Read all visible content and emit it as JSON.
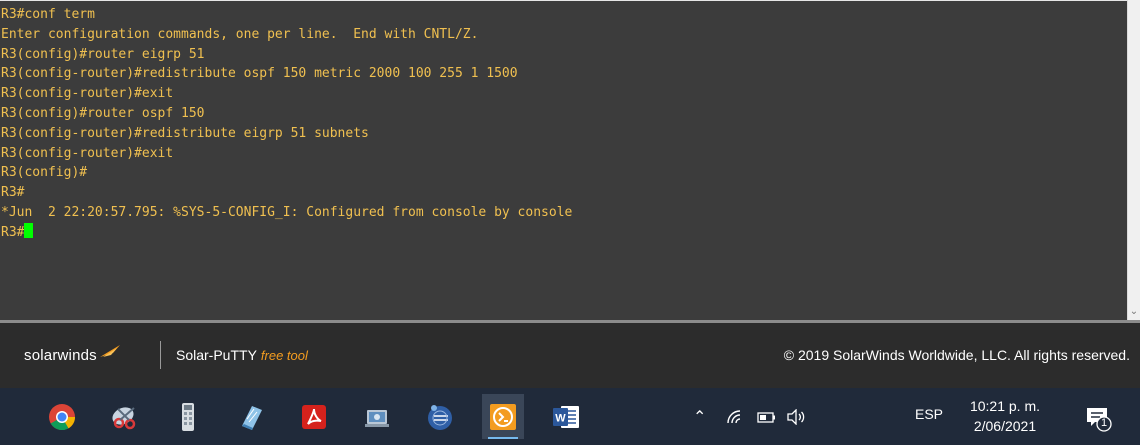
{
  "terminal": {
    "lines": [
      "R3#conf term",
      "Enter configuration commands, one per line.  End with CNTL/Z.",
      "R3(config)#router eigrp 51",
      "R3(config-router)#redistribute ospf 150 metric 2000 100 255 1 1500",
      "R3(config-router)#exit",
      "R3(config)#router ospf 150",
      "R3(config-router)#redistribute eigrp 51 subnets",
      "R3(config-router)#exit",
      "R3(config)#",
      "R3#",
      "*Jun  2 22:20:57.795: %SYS-5-CONFIG_I: Configured from console by console",
      "R3#"
    ],
    "text_color": "#f0c050",
    "background": "#3c3c3c",
    "cursor_color": "#00ff00"
  },
  "footer": {
    "brand": "solarwinds",
    "product": "Solar-PuTTY",
    "tag": "free tool",
    "copyright": "© 2019 SolarWinds Worldwide, LLC. All rights reserved.",
    "accent": "#f39c20"
  },
  "taskbar": {
    "apps": [
      {
        "icon": "chrome-icon"
      },
      {
        "icon": "snipping-tool-icon"
      },
      {
        "icon": "calculator-icon"
      },
      {
        "icon": "notepad-icon"
      },
      {
        "icon": "acrobat-reader-icon"
      },
      {
        "icon": "network-settings-icon"
      },
      {
        "icon": "eclipse-icon"
      },
      {
        "icon": "solar-putty-icon"
      },
      {
        "icon": "word-icon"
      }
    ],
    "language": "ESP",
    "time": "10:21 p. m.",
    "date": "2/06/2021",
    "notification_count": "1"
  }
}
